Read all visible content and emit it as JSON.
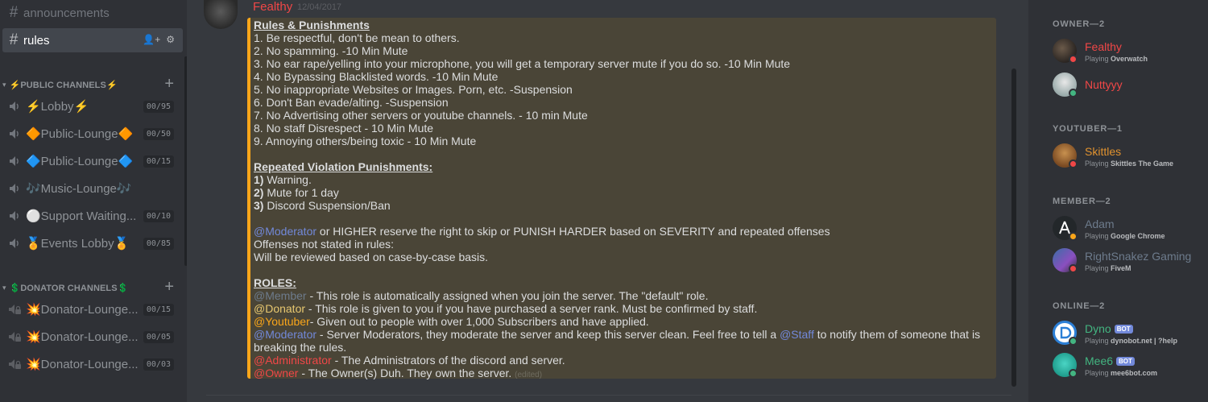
{
  "colors": {
    "accent": "#7289da",
    "embed_border": "#faa61a",
    "online": "#43b581",
    "dnd": "#f04747",
    "idle": "#faa61a"
  },
  "sidebar": {
    "channels": [
      {
        "name": "announcements",
        "active": false
      },
      {
        "name": "rules",
        "active": true
      }
    ],
    "categories": [
      {
        "label": "⚡PUBLIC CHANNELS⚡",
        "voice": [
          {
            "name": "⚡Lobby⚡",
            "count": "00/95"
          },
          {
            "name": "🔶Public-Lounge🔶",
            "count": "00/50"
          },
          {
            "name": "🔷Public-Lounge🔷",
            "count": "00/15"
          },
          {
            "name": "🎶Music-Lounge🎶",
            "count": ""
          },
          {
            "name": "⚪Support Waiting...",
            "count": "00/10"
          },
          {
            "name": "🏅Events Lobby🏅",
            "count": "00/85"
          }
        ]
      },
      {
        "label": "💲DONATOR CHANNELS💲",
        "voice": [
          {
            "name": "💥Donator-Lounge...",
            "count": "00/15"
          },
          {
            "name": "💥Donator-Lounge...",
            "count": "00/05"
          },
          {
            "name": "💥Donator-Lounge...",
            "count": "00/03"
          }
        ]
      }
    ]
  },
  "message": {
    "author": "Fealthy",
    "timestamp": "12/04/2017",
    "rules_title": "Rules & Punishments",
    "rules": [
      "1. Be respectful, don't be mean to others.",
      "2. No spamming. -10 Min Mute",
      "3. No ear rape/yelling into your microphone, you will get a temporary server mute if you do so. -10 Min Mute",
      "4. No Bypassing Blacklisted words. -10 Min Mute",
      "5. No inappropriate Websites or Images. Porn, etc. -Suspension",
      "6. Don't Ban evade/alting. -Suspension",
      "7. No Advertising other servers or youtube channels. - 10 min Mute",
      "8. No staff Disrespect - 10 Min Mute",
      "9. Annoying others/being toxic - 10 Min Mute"
    ],
    "repeat_title": "Repeated Violation Punishments:",
    "repeat": [
      {
        "num": "1)",
        "text": " Warning."
      },
      {
        "num": "2)",
        "text": " Mute for 1 day"
      },
      {
        "num": "3)",
        "text": " Discord Suspension/Ban"
      }
    ],
    "mod_mention": "@Moderator",
    "mod_text": " or HIGHER  reserve the right to skip or PUNISH HARDER  based on SEVERITY and repeated offenses",
    "offenses_1": "Offenses not stated in rules:",
    "offenses_2": "Will be reviewed based on case-by-case basis.",
    "roles_title": "ROLES:",
    "roles": {
      "member_tag": "@Member",
      "member_text": " - This role is automatically assigned when you join the server. The \"default\" role.",
      "donator_tag": "@Donator",
      "donator_text": " - This role is given to you if you have purchased a server rank. Must be confirmed by staff.",
      "youtuber_tag": "@Youtuber",
      "youtuber_text": "- Given out to people with over 1,000 Subscribers  and have applied.",
      "moderator_tag": "@Moderator",
      "moderator_text": "  - Server Moderators, they moderate the server and keep this server clean. Feel free to tell a ",
      "staff_tag": "@Staff",
      "moderator_text2": " to notify them of someone that is",
      "moderator_text3": "breaking the rules.",
      "admin_tag": "@Administrator",
      "admin_text": " - The Administrators of the discord and server.",
      "owner_tag": "@Owner",
      "owner_text": "  - The Owner(s) Duh. They own the server.",
      "edited": "(edited)"
    }
  },
  "members": {
    "groups": [
      {
        "title": "OWNER—2",
        "items": [
          {
            "name": "Fealthy",
            "color": "#f04747",
            "playing_prefix": "Playing ",
            "game": "Overwatch",
            "status": "dnd"
          },
          {
            "name": "Nuttyyy",
            "color": "#f04747",
            "playing_prefix": "",
            "game": "",
            "status": "online"
          }
        ]
      },
      {
        "title": "YOUTUBER—1",
        "items": [
          {
            "name": "Skittles",
            "color": "#e0922f",
            "playing_prefix": "Playing ",
            "game": "Skittles The Game",
            "status": "dnd"
          }
        ]
      },
      {
        "title": "MEMBER—2",
        "items": [
          {
            "name": "Adam",
            "color": "#6d7b8c",
            "playing_prefix": "Playing ",
            "game": "Google Chrome",
            "status": "idle"
          },
          {
            "name": "RightSnakez Gaming",
            "color": "#6d7b8c",
            "playing_prefix": "Playing ",
            "game": "FiveM",
            "status": "dnd"
          }
        ]
      },
      {
        "title": "ONLINE—2",
        "items": [
          {
            "name": "Dyno",
            "color": "#43b581",
            "bot": "BOT",
            "playing_prefix": "Playing ",
            "game": "dynobot.net | ?help",
            "status": "online"
          },
          {
            "name": "Mee6",
            "color": "#43b581",
            "bot": "BOT",
            "playing_prefix": "Playing ",
            "game": "mee6bot.com",
            "status": "online"
          }
        ]
      }
    ]
  }
}
